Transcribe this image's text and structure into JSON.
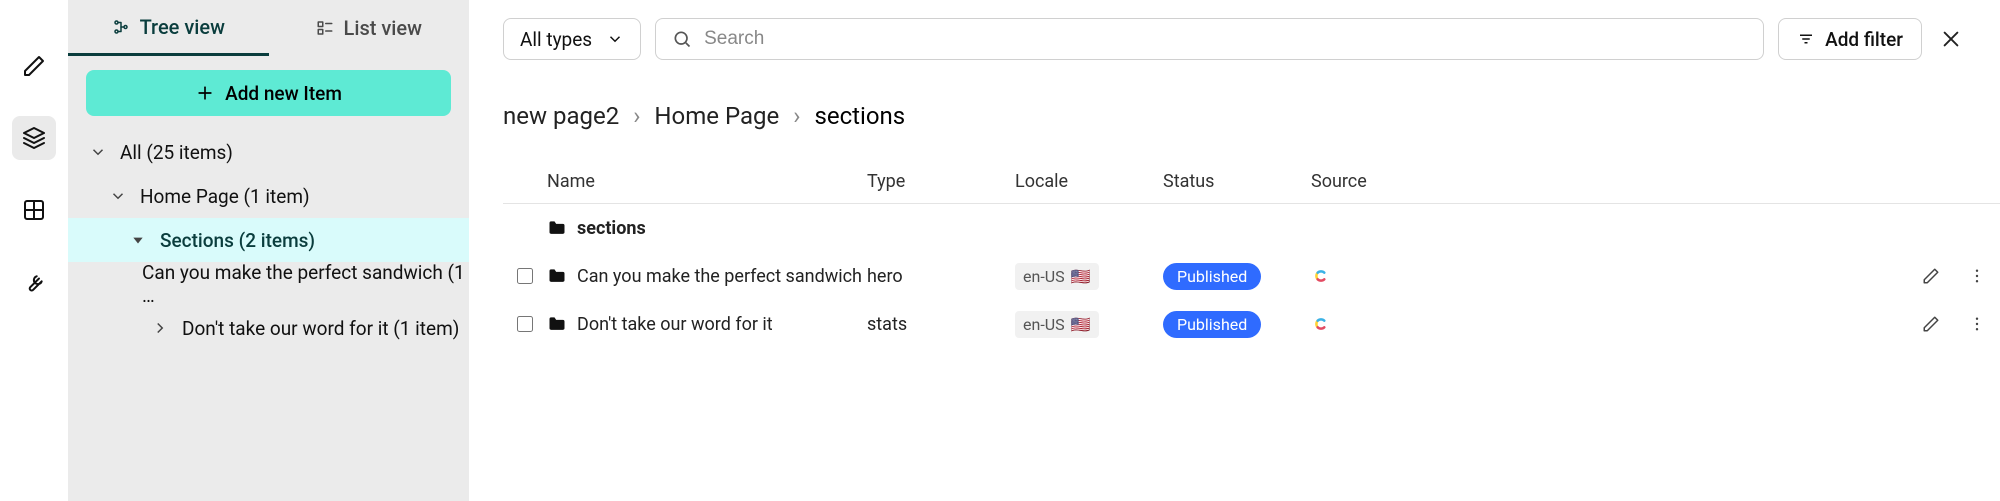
{
  "view_tabs": {
    "tree": "Tree view",
    "list": "List view"
  },
  "add_button": "Add new Item",
  "tree": {
    "all": "All (25 items)",
    "home": "Home Page (1 item)",
    "sections": "Sections (2 items)",
    "sandwich": "Can you make the perfect sandwich (1 …",
    "dont": "Don't take our word for it (1 item)"
  },
  "toolbar": {
    "types": "All types",
    "search_placeholder": "Search",
    "add_filter": "Add filter"
  },
  "breadcrumbs": {
    "a": "new page2",
    "b": "Home Page",
    "c": "sections"
  },
  "columns": {
    "name": "Name",
    "type": "Type",
    "locale": "Locale",
    "status": "Status",
    "source": "Source"
  },
  "folder": {
    "name": "sections"
  },
  "rows": [
    {
      "name": "Can you make the perfect sandwich",
      "type": "hero",
      "locale": "en-US",
      "flag": "🇺🇸",
      "status": "Published"
    },
    {
      "name": "Don't take our word for it",
      "type": "stats",
      "locale": "en-US",
      "flag": "🇺🇸",
      "status": "Published"
    }
  ]
}
